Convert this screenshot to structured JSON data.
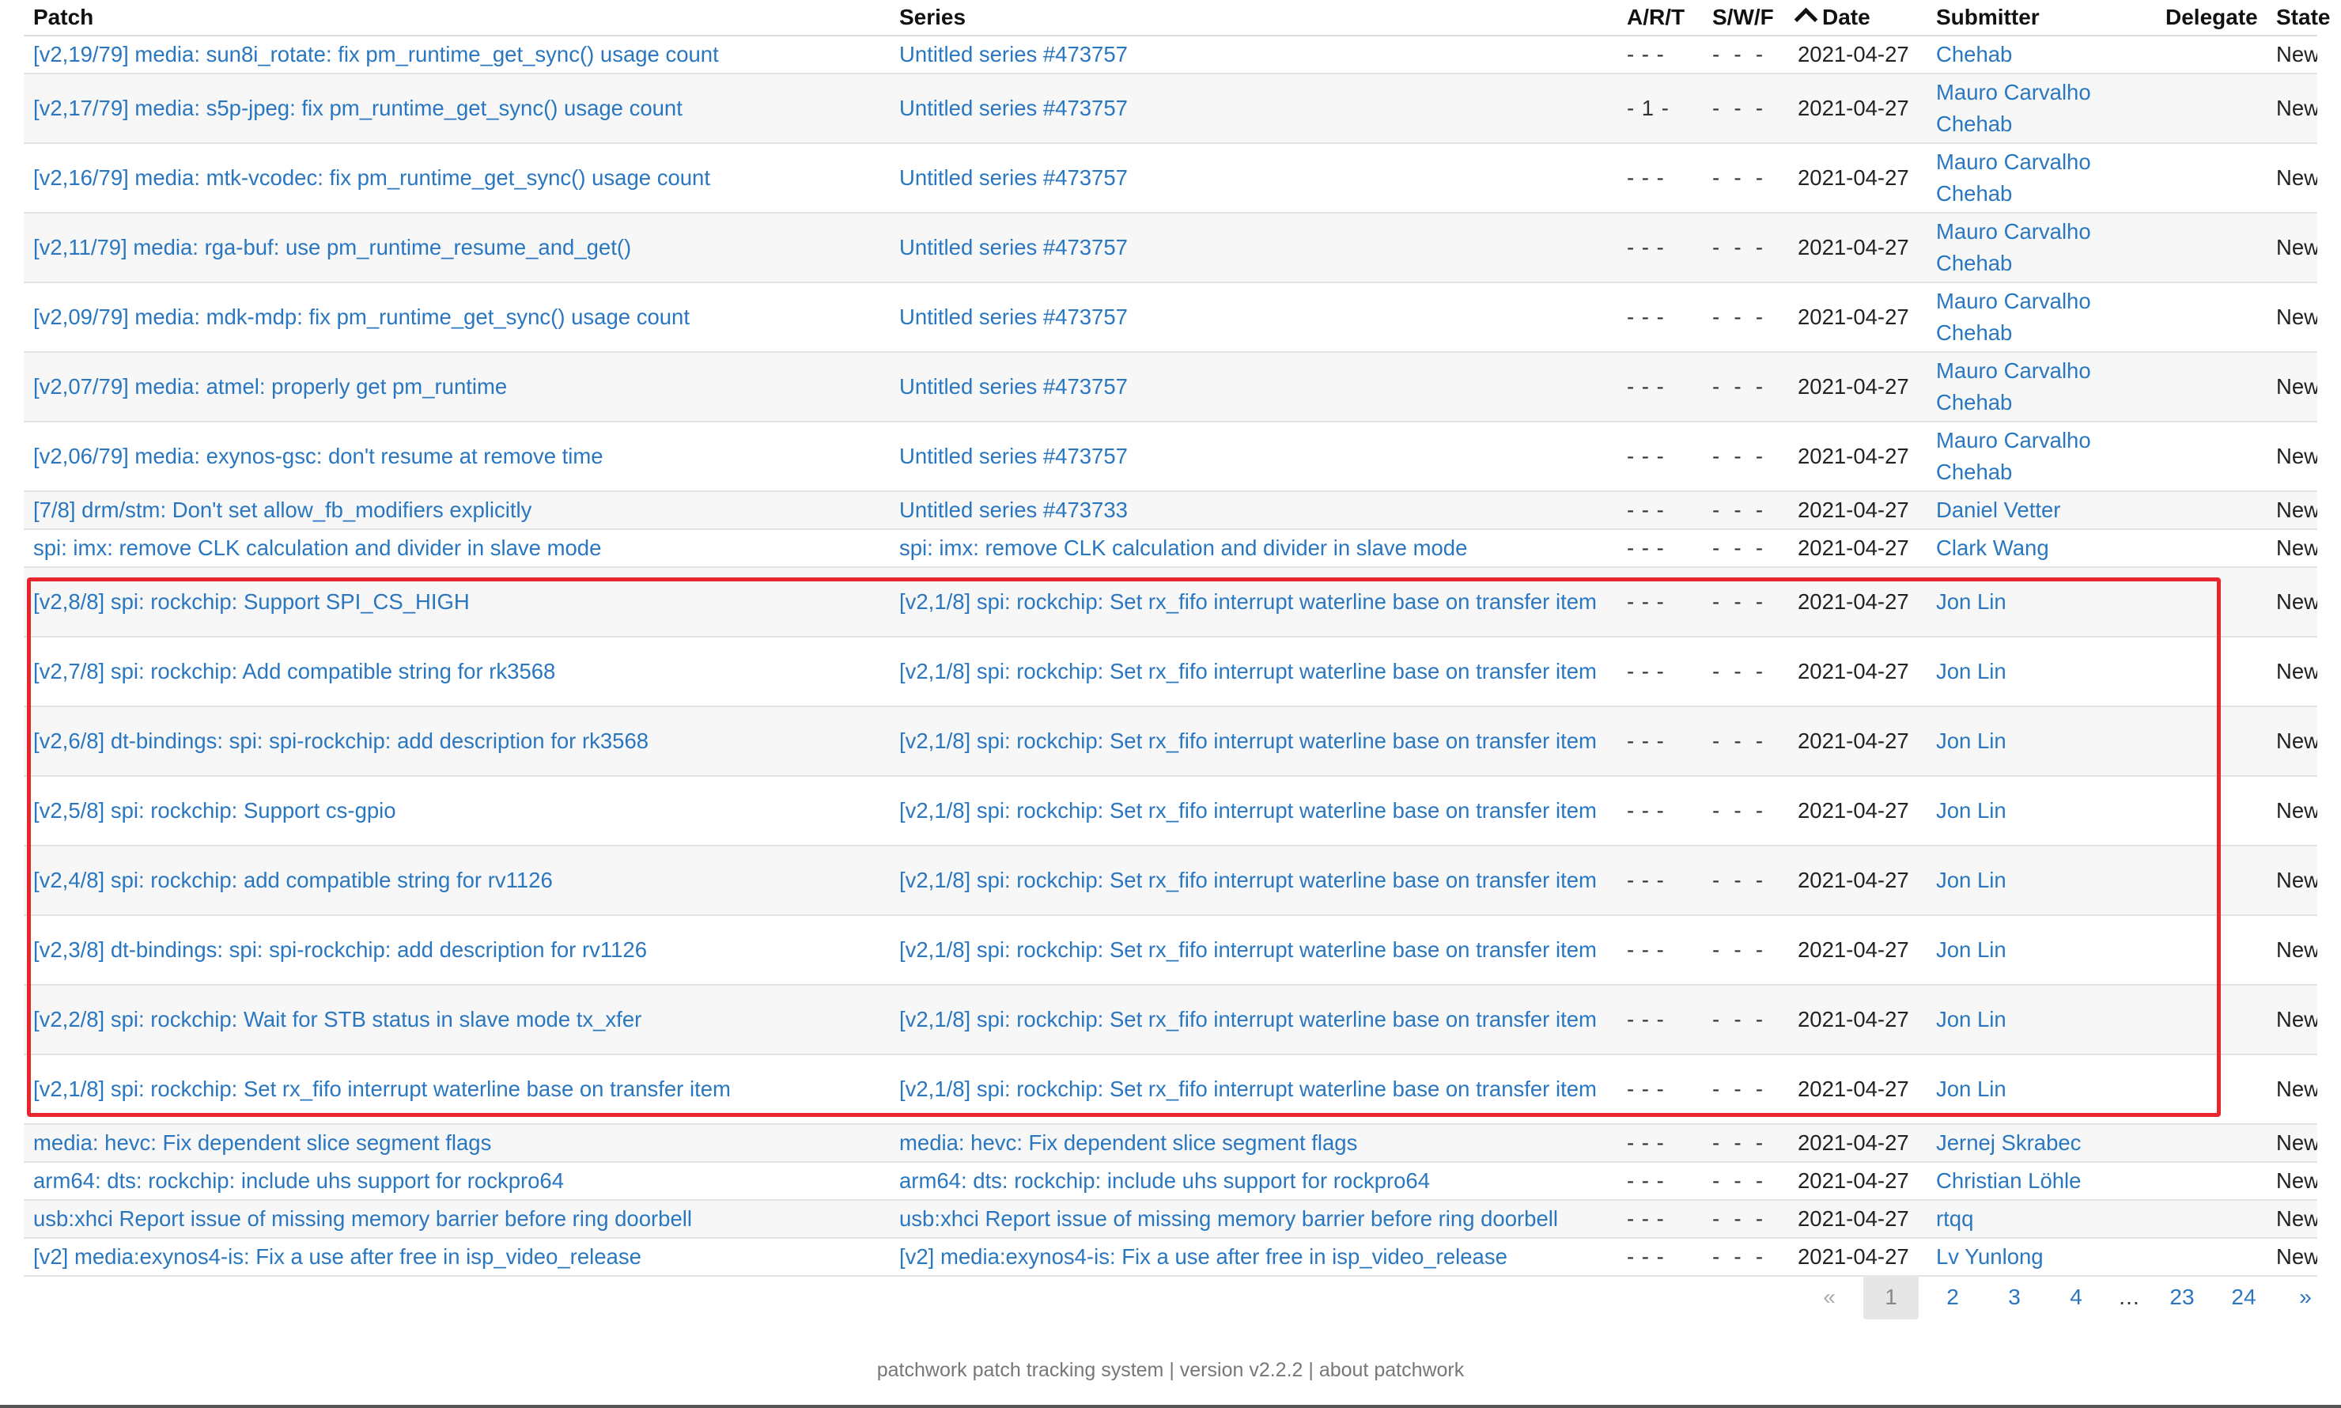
{
  "columns": {
    "patch": "Patch",
    "series": "Series",
    "art": "A/R/T",
    "swf": "S/W/F",
    "date": "Date",
    "submitter": "Submitter",
    "delegate": "Delegate",
    "state": "State"
  },
  "rows": [
    {
      "patch": "[v2,19/79] media: sun8i_rotate: fix pm_runtime_get_sync() usage count",
      "series": "Untitled series #473757",
      "art": "- - -",
      "swf": "-  -  -",
      "date": "2021-04-27",
      "submitter": "Chehab",
      "delegate": "",
      "state": "New"
    },
    {
      "patch": "[v2,17/79] media: s5p-jpeg: fix pm_runtime_get_sync() usage count",
      "series": "Untitled series #473757",
      "art": "- 1 -",
      "swf": "-  -  -",
      "date": "2021-04-27",
      "submitter": "Mauro Carvalho Chehab",
      "delegate": "",
      "state": "New"
    },
    {
      "patch": "[v2,16/79] media: mtk-vcodec: fix pm_runtime_get_sync() usage count",
      "series": "Untitled series #473757",
      "art": "- - -",
      "swf": "-  -  -",
      "date": "2021-04-27",
      "submitter": "Mauro Carvalho Chehab",
      "delegate": "",
      "state": "New"
    },
    {
      "patch": "[v2,11/79] media: rga-buf: use pm_runtime_resume_and_get()",
      "series": "Untitled series #473757",
      "art": "- - -",
      "swf": "-  -  -",
      "date": "2021-04-27",
      "submitter": "Mauro Carvalho Chehab",
      "delegate": "",
      "state": "New"
    },
    {
      "patch": "[v2,09/79] media: mdk-mdp: fix pm_runtime_get_sync() usage count",
      "series": "Untitled series #473757",
      "art": "- - -",
      "swf": "-  -  -",
      "date": "2021-04-27",
      "submitter": "Mauro Carvalho Chehab",
      "delegate": "",
      "state": "New"
    },
    {
      "patch": "[v2,07/79] media: atmel: properly get pm_runtime",
      "series": "Untitled series #473757",
      "art": "- - -",
      "swf": "-  -  -",
      "date": "2021-04-27",
      "submitter": "Mauro Carvalho Chehab",
      "delegate": "",
      "state": "New"
    },
    {
      "patch": "[v2,06/79] media: exynos-gsc: don't resume at remove time",
      "series": "Untitled series #473757",
      "art": "- - -",
      "swf": "-  -  -",
      "date": "2021-04-27",
      "submitter": "Mauro Carvalho Chehab",
      "delegate": "",
      "state": "New"
    },
    {
      "patch": "[7/8] drm/stm: Don't set allow_fb_modifiers explicitly",
      "series": "Untitled series #473733",
      "art": "- - -",
      "swf": "-  -  -",
      "date": "2021-04-27",
      "submitter": "Daniel Vetter",
      "delegate": "",
      "state": "New"
    },
    {
      "patch": "spi: imx: remove CLK calculation and divider in slave mode",
      "series": "spi: imx: remove CLK calculation and divider in slave mode",
      "art": "- - -",
      "swf": "-  -  -",
      "date": "2021-04-27",
      "submitter": "Clark Wang",
      "delegate": "",
      "state": "New"
    },
    {
      "patch": "[v2,8/8] spi: rockchip: Support SPI_CS_HIGH",
      "series": "[v2,1/8] spi: rockchip: Set rx_fifo interrupt waterline base on transfer item",
      "art": "- - -",
      "swf": "-  -  -",
      "date": "2021-04-27",
      "submitter": "Jon Lin",
      "delegate": "",
      "state": "New"
    },
    {
      "patch": "[v2,7/8] spi: rockchip: Add compatible string for rk3568",
      "series": "[v2,1/8] spi: rockchip: Set rx_fifo interrupt waterline base on transfer item",
      "art": "- - -",
      "swf": "-  -  -",
      "date": "2021-04-27",
      "submitter": "Jon Lin",
      "delegate": "",
      "state": "New"
    },
    {
      "patch": "[v2,6/8] dt-bindings: spi: spi-rockchip: add description for rk3568",
      "series": "[v2,1/8] spi: rockchip: Set rx_fifo interrupt waterline base on transfer item",
      "art": "- - -",
      "swf": "-  -  -",
      "date": "2021-04-27",
      "submitter": "Jon Lin",
      "delegate": "",
      "state": "New"
    },
    {
      "patch": "[v2,5/8] spi: rockchip: Support cs-gpio",
      "series": "[v2,1/8] spi: rockchip: Set rx_fifo interrupt waterline base on transfer item",
      "art": "- - -",
      "swf": "-  -  -",
      "date": "2021-04-27",
      "submitter": "Jon Lin",
      "delegate": "",
      "state": "New"
    },
    {
      "patch": "[v2,4/8] spi: rockchip: add compatible string for rv1126",
      "series": "[v2,1/8] spi: rockchip: Set rx_fifo interrupt waterline base on transfer item",
      "art": "- - -",
      "swf": "-  -  -",
      "date": "2021-04-27",
      "submitter": "Jon Lin",
      "delegate": "",
      "state": "New"
    },
    {
      "patch": "[v2,3/8] dt-bindings: spi: spi-rockchip: add description for rv1126",
      "series": "[v2,1/8] spi: rockchip: Set rx_fifo interrupt waterline base on transfer item",
      "art": "- - -",
      "swf": "-  -  -",
      "date": "2021-04-27",
      "submitter": "Jon Lin",
      "delegate": "",
      "state": "New"
    },
    {
      "patch": "[v2,2/8] spi: rockchip: Wait for STB status in slave mode tx_xfer",
      "series": "[v2,1/8] spi: rockchip: Set rx_fifo interrupt waterline base on transfer item",
      "art": "- - -",
      "swf": "-  -  -",
      "date": "2021-04-27",
      "submitter": "Jon Lin",
      "delegate": "",
      "state": "New"
    },
    {
      "patch": "[v2,1/8] spi: rockchip: Set rx_fifo interrupt waterline base on transfer item",
      "series": "[v2,1/8] spi: rockchip: Set rx_fifo interrupt waterline base on transfer item",
      "art": "- - -",
      "swf": "-  -  -",
      "date": "2021-04-27",
      "submitter": "Jon Lin",
      "delegate": "",
      "state": "New"
    },
    {
      "patch": "media: hevc: Fix dependent slice segment flags",
      "series": "media: hevc: Fix dependent slice segment flags",
      "art": "- - -",
      "swf": "-  -  -",
      "date": "2021-04-27",
      "submitter": "Jernej Skrabec",
      "delegate": "",
      "state": "New"
    },
    {
      "patch": "arm64: dts: rockchip: include uhs support for rockpro64",
      "series": "arm64: dts: rockchip: include uhs support for rockpro64",
      "art": "- - -",
      "swf": "-  -  -",
      "date": "2021-04-27",
      "submitter": "Christian Löhle",
      "delegate": "",
      "state": "New"
    },
    {
      "patch": "usb:xhci Report issue of missing memory barrier before ring doorbell",
      "series": "usb:xhci Report issue of missing memory barrier before ring doorbell",
      "art": "- - -",
      "swf": "-  -  -",
      "date": "2021-04-27",
      "submitter": "rtqq",
      "delegate": "",
      "state": "New"
    },
    {
      "patch": "[v2] media:exynos4-is: Fix a use after free in isp_video_release",
      "series": "[v2] media:exynos4-is: Fix a use after free in isp_video_release",
      "art": "- - -",
      "swf": "-  -  -",
      "date": "2021-04-27",
      "submitter": "Lv Yunlong",
      "delegate": "",
      "state": "New"
    }
  ],
  "pagination": {
    "prev": "«",
    "pages": [
      "1",
      "2",
      "3",
      "4"
    ],
    "ellipsis": "…",
    "last_pages": [
      "23",
      "24"
    ],
    "next": "»",
    "current": "1"
  },
  "footer": {
    "system": "patchwork patch tracking system",
    "sep1": " | ",
    "version": "version v2.2.2",
    "sep2": " | ",
    "about": "about patchwork"
  },
  "colors": {
    "link": "#2a77bf",
    "highlight": "#e8262b"
  }
}
